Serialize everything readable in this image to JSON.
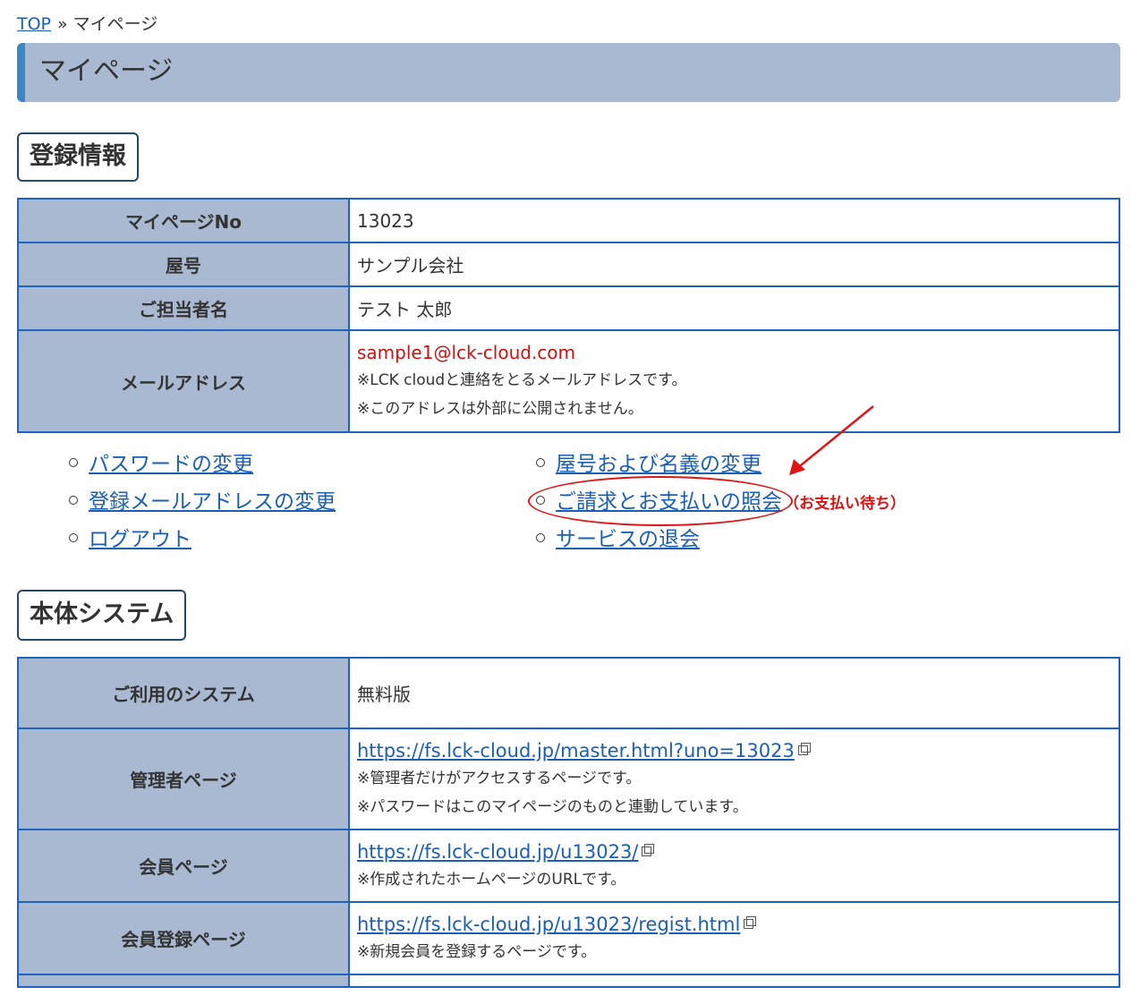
{
  "breadcrumb": {
    "top": "TOP",
    "separator": "»",
    "current": "マイページ"
  },
  "page_title": "マイページ",
  "registration": {
    "heading": "登録情報",
    "rows": [
      {
        "label": "マイページNo",
        "value": "13023"
      },
      {
        "label": "屋号",
        "value": "サンプル会社"
      },
      {
        "label": "ご担当者名",
        "value": "テスト 太郎"
      }
    ],
    "email": {
      "label": "メールアドレス",
      "value": "sample1@lck-cloud.com",
      "note1": "※LCK cloudと連絡をとるメールアドレスです。",
      "note2": "※このアドレスは外部に公開されません。"
    }
  },
  "account_links": {
    "left": [
      "パスワードの変更",
      "登録メールアドレスの変更",
      "ログアウト"
    ],
    "right": [
      "屋号および名義の変更",
      "ご請求とお支払いの照会",
      "サービスの退会"
    ],
    "awaiting_payment": "（お支払い待ち）"
  },
  "system": {
    "heading": "本体システム",
    "plan": {
      "label": "ご利用のシステム",
      "value": "無料版"
    },
    "admin": {
      "label": "管理者ページ",
      "url": "https://fs.lck-cloud.jp/master.html?uno=13023",
      "note1": "※管理者だけがアクセスするページです。",
      "note2": "※パスワードはこのマイページのものと連動しています。"
    },
    "member": {
      "label": "会員ページ",
      "url": "https://fs.lck-cloud.jp/u13023/",
      "note1": "※作成されたホームページのURLです。"
    },
    "register": {
      "label": "会員登録ページ",
      "url": "https://fs.lck-cloud.jp/u13023/regist.html",
      "note1": "※新規会員を登録するページです。"
    }
  },
  "colors": {
    "accent": "#3a87c3",
    "header_bg": "#a8b9d1",
    "border": "#1f63c1",
    "link": "#1a5fb4",
    "annotation": "#e01515"
  }
}
